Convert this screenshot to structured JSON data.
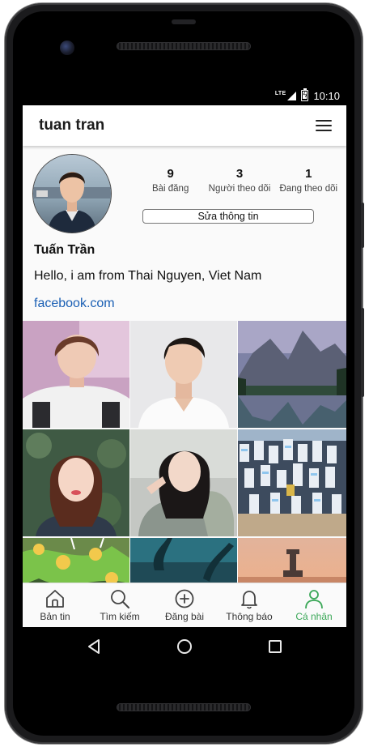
{
  "status": {
    "network": "LTE",
    "time": "10:10"
  },
  "appbar": {
    "title": "tuan tran"
  },
  "profile": {
    "stats": [
      {
        "count": "9",
        "label": "Bài đăng"
      },
      {
        "count": "3",
        "label": "Người theo dõi"
      },
      {
        "count": "1",
        "label": "Đang theo dõi"
      }
    ],
    "edit_label": "Sửa thông tin",
    "name": "Tuấn Trần",
    "bio": "Hello, i am from Thai Nguyen, Viet Nam",
    "link": "facebook.com"
  },
  "bottom_nav": [
    {
      "label": "Bản tin",
      "icon": "home-icon"
    },
    {
      "label": "Tìm kiếm",
      "icon": "search-icon"
    },
    {
      "label": "Đăng bài",
      "icon": "add-circle-icon"
    },
    {
      "label": "Thông báo",
      "icon": "bell-icon"
    },
    {
      "label": "Cá nhân",
      "icon": "person-icon",
      "active": true
    }
  ],
  "colors": {
    "accent": "#3aa757",
    "link": "#1a5fb4"
  }
}
